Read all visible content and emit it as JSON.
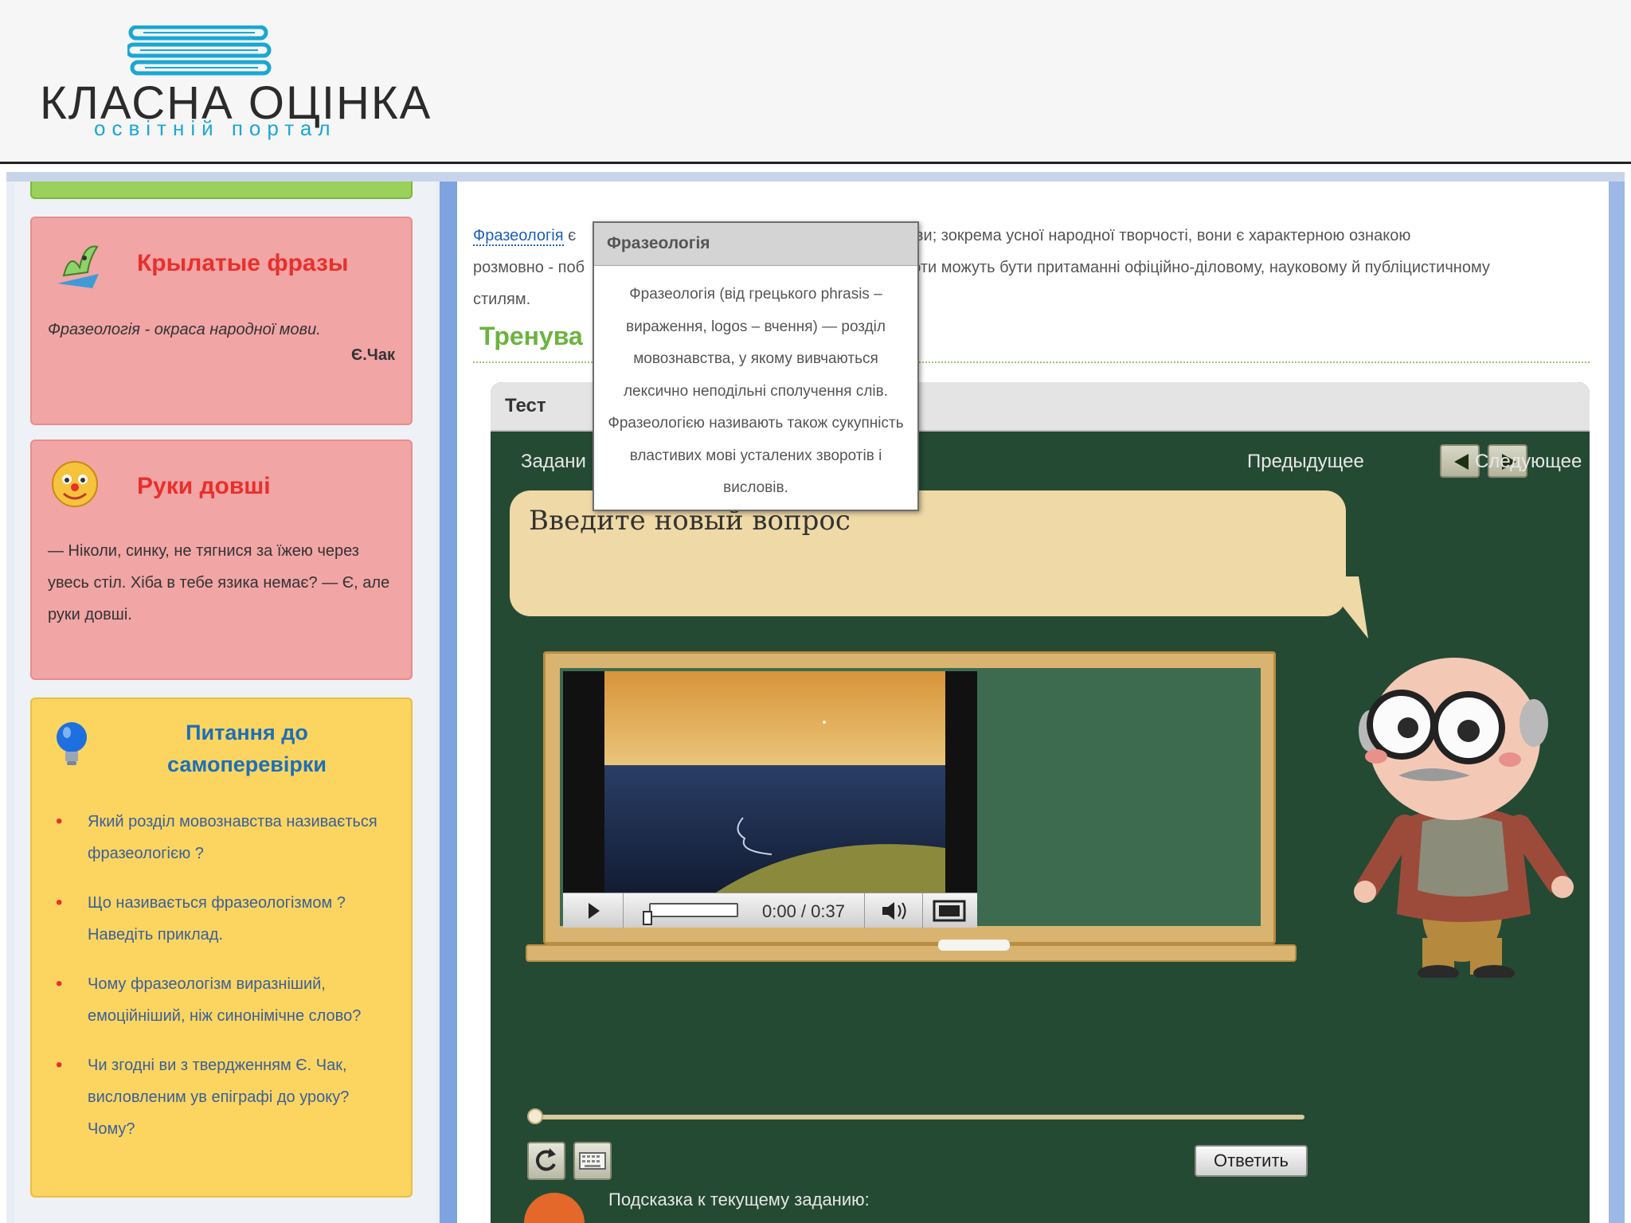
{
  "header": {
    "logo_title": "КЛАСНА ОЦІНКА",
    "logo_subtitle": "освітній портал"
  },
  "sidebar": {
    "winged_phrases": {
      "title": "Крылатые фразы",
      "quote": "Фразеологія - окраса народної мови.",
      "author": "Є.Чак"
    },
    "joke": {
      "title": "Руки довші",
      "text": "— Ніколи, синку, не тягнися за їжею через увесь стіл. Хіба в тебе язика немає? — Є, але руки довші."
    },
    "questions": {
      "title": "Питання до самоперевірки",
      "items": [
        "Який розділ мовознавства називається фразеологією ?",
        "Що називається фразеологізмом ? Наведіть приклад.",
        "Чому фразеологізм виразніший, емоційніший, ніж синонімічне слово?",
        "Чи згодні ви з твердженням Є. Чак, висловленим ув епіграфі до уроку? Чому?"
      ]
    }
  },
  "main": {
    "intro_link": "Фразеологія",
    "intro_fragment_1": " є ",
    "intro_fragment_2": "ї мови; зокрема усної народної творчості, вони є характерною ознакою",
    "intro_line_2a": "розмовно - поб",
    "intro_line_2b": "роти можуть бути притаманні офіційно-діловому, науковому й публіцистичному",
    "intro_line_3": "стилям.",
    "section_title": "Тренува",
    "test": {
      "header_label": "Тест",
      "task_label": "Задани",
      "prev_label": "Предыдущее",
      "next_label": "Следующее",
      "question": "Введите новый вопрос",
      "video_time": "0:00 / 0:37",
      "video_progress": 0,
      "answer_button": "Ответить",
      "hint_label": "Подсказка к текущему заданию:"
    }
  },
  "tooltip": {
    "title": "Фразеологія",
    "body": "Фразеологія (від грецького phrasis – вираження, logos – вчення) — розділ мовознавства, у якому вивчаються лексично неподільні сполучення слів. Фразеологією називають також сукупність властивих мові усталених зворотів і висловів."
  },
  "colors": {
    "accent_blue": "#1d6fb8",
    "title_red": "#e8302c",
    "section_green": "#6cb33f",
    "board_green": "#244a34"
  }
}
